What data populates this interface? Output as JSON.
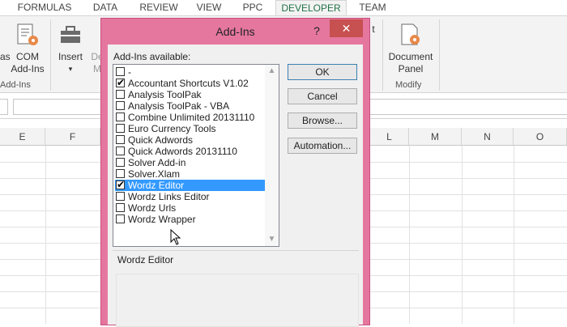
{
  "ribbon_tabs": [
    "FORMULAS",
    "DATA",
    "REVIEW",
    "VIEW",
    "PPC",
    "DEVELOPER",
    "TEAM"
  ],
  "ribbon": {
    "com_addins_label": [
      "COM",
      "Add-Ins"
    ],
    "as_label": "as",
    "addins_group": "Add-Ins",
    "insert_label": "Insert",
    "design_label": [
      "De",
      "M"
    ],
    "document_panel_label": [
      "Document",
      "Panel"
    ],
    "modify_group": "Modify",
    "partial_t": "t"
  },
  "columns": [
    "E",
    "F",
    "L",
    "M",
    "N",
    "O"
  ],
  "dialog": {
    "title": "Add-Ins",
    "help_glyph": "?",
    "close_glyph": "✕",
    "available_label": "Add-Ins available:",
    "items": [
      {
        "label": "-",
        "checked": false,
        "selected": false
      },
      {
        "label": "Accountant Shortcuts V1.02",
        "checked": true,
        "selected": false
      },
      {
        "label": "Analysis ToolPak",
        "checked": false,
        "selected": false
      },
      {
        "label": "Analysis ToolPak - VBA",
        "checked": false,
        "selected": false
      },
      {
        "label": "Combine Unlimited 20131110",
        "checked": false,
        "selected": false
      },
      {
        "label": "Euro Currency Tools",
        "checked": false,
        "selected": false
      },
      {
        "label": "Quick Adwords",
        "checked": false,
        "selected": false
      },
      {
        "label": "Quick Adwords 20131110",
        "checked": false,
        "selected": false
      },
      {
        "label": "Solver Add-in",
        "checked": false,
        "selected": false
      },
      {
        "label": "Solver.Xlam",
        "checked": false,
        "selected": false
      },
      {
        "label": "Wordz Editor",
        "checked": true,
        "selected": true
      },
      {
        "label": "Wordz Links Editor",
        "checked": false,
        "selected": false
      },
      {
        "label": "Wordz Urls",
        "checked": false,
        "selected": false
      },
      {
        "label": "Wordz Wrapper",
        "checked": false,
        "selected": false
      }
    ],
    "buttons": {
      "ok": "OK",
      "cancel": "Cancel",
      "browse": "Browse...",
      "automation": "Automation..."
    },
    "description_title": "Wordz Editor",
    "scroll_up": "▲",
    "scroll_down": "▼"
  },
  "colors": {
    "accent": "#217346",
    "dialog_frame": "#e5779e",
    "close_button": "#c75050",
    "selection": "#3399ff"
  }
}
